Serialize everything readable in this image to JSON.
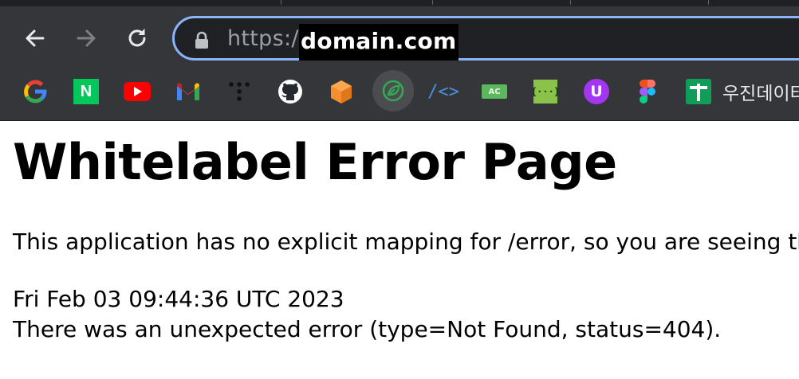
{
  "browser": {
    "url_scheme": "https:/",
    "url_host": "domain.com",
    "bookmarks": [
      {
        "icon": "google-icon"
      },
      {
        "icon": "naver-icon",
        "letter": "N"
      },
      {
        "icon": "youtube-icon"
      },
      {
        "icon": "gmail-icon"
      },
      {
        "icon": "dots-icon"
      },
      {
        "icon": "github-icon"
      },
      {
        "icon": "orange-cube-icon"
      },
      {
        "icon": "leaf-icon"
      },
      {
        "icon": "code-brackets-icon",
        "label": "/<>"
      },
      {
        "icon": "ac-icon",
        "label": "AC"
      },
      {
        "icon": "braces-icon",
        "label": "{···}"
      },
      {
        "icon": "udemy-icon",
        "label": "U"
      },
      {
        "icon": "figma-icon"
      },
      {
        "icon": "plus-icon"
      }
    ],
    "bookmark_text": "우진데이터"
  },
  "page": {
    "title": "Whitelabel Error Page",
    "message": "This application has no explicit mapping for /error, so you are seeing this as a fallback.",
    "timestamp": "Fri Feb 03 09:44:36 UTC 2023",
    "error": "There was an unexpected error (type=Not Found, status=404)."
  },
  "colors": {
    "chrome_bg": "#35363a",
    "omnibox_border": "#8ab4f8",
    "omnibox_bg": "#202124"
  }
}
